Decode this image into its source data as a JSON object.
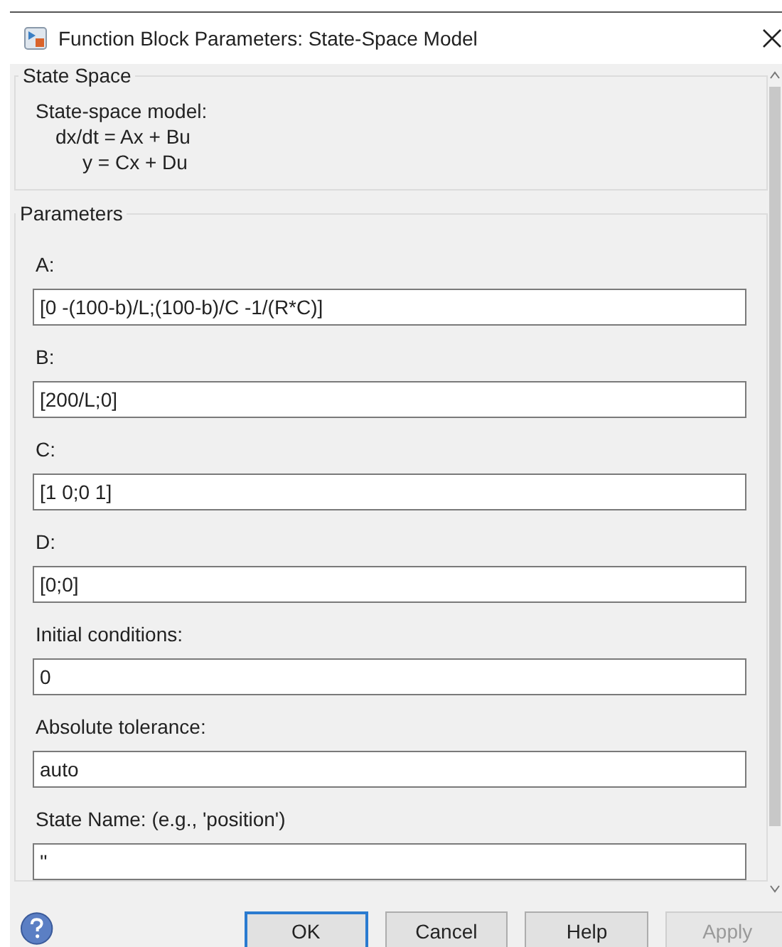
{
  "window": {
    "title": "Function Block Parameters: State-Space Model"
  },
  "description": {
    "heading": "State Space",
    "lines": [
      "State-space model:",
      "dx/dt = Ax + Bu",
      "y = Cx + Du"
    ]
  },
  "parameters": {
    "heading": "Parameters",
    "fields": [
      {
        "label": "A:",
        "value": "[0 -(100-b)/L;(100-b)/C -1/(R*C)]"
      },
      {
        "label": "B:",
        "value": "[200/L;0]"
      },
      {
        "label": "C:",
        "value": "[1 0;0 1]"
      },
      {
        "label": "D:",
        "value": "[0;0]"
      },
      {
        "label": "Initial conditions:",
        "value": "0"
      },
      {
        "label": "Absolute tolerance:",
        "value": "auto"
      },
      {
        "label": "State Name: (e.g., 'position')",
        "value": "''"
      }
    ]
  },
  "buttons": [
    {
      "label": "OK",
      "default": true,
      "disabled": false
    },
    {
      "label": "Cancel",
      "default": false,
      "disabled": false
    },
    {
      "label": "Help",
      "default": false,
      "disabled": false
    },
    {
      "label": "Apply",
      "default": false,
      "disabled": true
    }
  ]
}
